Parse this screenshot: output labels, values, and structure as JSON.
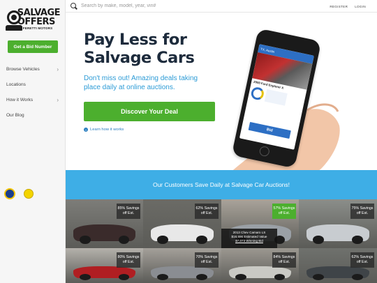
{
  "brand": {
    "line1": "SALVAGE",
    "line2": "OFFERS",
    "line3": "BY FERETTI MOTORS"
  },
  "sidebar": {
    "cta_label": "Get a Bid Number",
    "items": [
      {
        "label": "Browse Vehicles",
        "has_chevron": true
      },
      {
        "label": "Locations",
        "has_chevron": false
      },
      {
        "label": "How it Works",
        "has_chevron": true
      },
      {
        "label": "Our Blog",
        "has_chevron": false
      }
    ],
    "chevron": "›"
  },
  "search": {
    "placeholder": "Search by make, model, year, vin#",
    "value": ""
  },
  "top_links": {
    "register": "REGISTER",
    "login": "LOGIN"
  },
  "hero": {
    "title": "Pay Less for Salvage Cars",
    "subtitle": "Don't miss out! Amazing deals taking place daily at online auctions.",
    "cta_label": "Discover Your Deal",
    "learn_link": "Learn how it works",
    "info_glyph": "i"
  },
  "phone": {
    "header": "TX, Austin",
    "vehicle": "2000 Ford Explorer X",
    "bid_label": "Bid"
  },
  "band": {
    "text": "Our Customers Save Daily at Salvage Car Auctions!"
  },
  "cars": [
    {
      "savings": "85% Savings",
      "sub": "off Est.",
      "color": "#3a2b2b",
      "bg": "#7d7d79",
      "highlight": false
    },
    {
      "savings": "62% Savings",
      "sub": "off Est.",
      "color": "#e8e8e8",
      "bg": "#6b6b66",
      "highlight": false
    },
    {
      "savings": "57% Savings",
      "sub": "off Est.",
      "color": "#9aa0a6",
      "bg": "#a9a39a",
      "highlight": true,
      "detail": {
        "vehicle": "2013 Chev Camaro LS",
        "est": "$16,696 Estimated Value",
        "win": "$7,073 Winning Bid"
      }
    },
    {
      "savings": "75% Savings",
      "sub": "off Est.",
      "color": "#c8ccd0",
      "bg": "#8b8e8a",
      "highlight": false
    },
    {
      "savings": "80% Savings",
      "sub": "off Est.",
      "color": "#b01e22",
      "bg": "#b4b1ab",
      "highlight": false
    },
    {
      "savings": "70% Savings",
      "sub": "off Est.",
      "color": "#8a8d92",
      "bg": "#a4a09a",
      "highlight": false
    },
    {
      "savings": "84% Savings",
      "sub": "off Est.",
      "color": "#c9c9c4",
      "bg": "#9c9891",
      "highlight": false
    },
    {
      "savings": "62% Savings",
      "sub": "off Est.",
      "color": "#3f4448",
      "bg": "#6f716d",
      "highlight": false
    }
  ]
}
